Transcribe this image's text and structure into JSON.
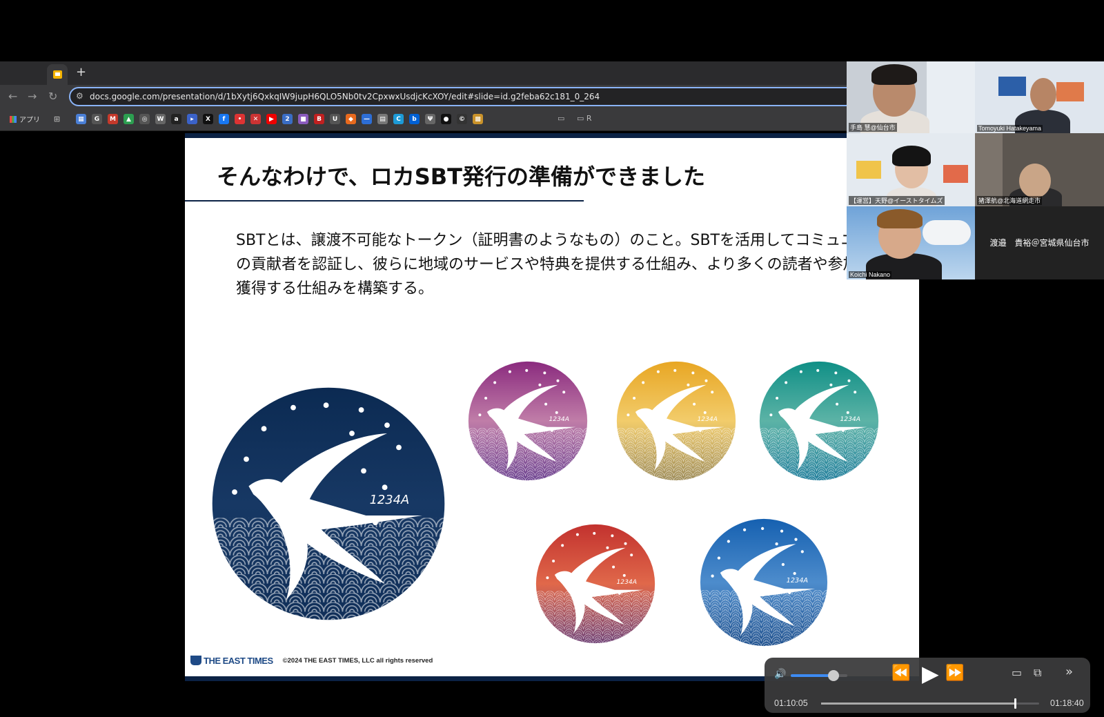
{
  "browser": {
    "url": "docs.google.com/presentation/d/1bXytj6QxkqIW9jupH6QLO5Nb0tv2CpxwxUsdjcKcXOY/edit#slide=id.g2feba62c181_0_264",
    "new_tab_glyph": "+",
    "apps_label": "アプリ",
    "bookmarks": [
      {
        "glyph": "▦",
        "color": "#4a7fd6"
      },
      {
        "glyph": "G",
        "color": "#555"
      },
      {
        "glyph": "M",
        "color": "#c5392b"
      },
      {
        "glyph": "▲",
        "color": "#2c9e50"
      },
      {
        "glyph": "◎",
        "color": "#555"
      },
      {
        "glyph": "W",
        "color": "#666"
      },
      {
        "glyph": "a",
        "color": "#222"
      },
      {
        "glyph": "▸",
        "color": "#3b62c8"
      },
      {
        "glyph": "X",
        "color": "#111"
      },
      {
        "glyph": "f",
        "color": "#1877f2"
      },
      {
        "glyph": "•",
        "color": "#d33"
      },
      {
        "glyph": "✕",
        "color": "#c33"
      },
      {
        "glyph": "▶",
        "color": "#e00"
      },
      {
        "glyph": "2",
        "color": "#3a6dc4"
      },
      {
        "glyph": "■",
        "color": "#8a5bbd"
      },
      {
        "glyph": "B",
        "color": "#c02020"
      },
      {
        "glyph": "U",
        "color": "#555"
      },
      {
        "glyph": "◆",
        "color": "#e86a1e"
      },
      {
        "glyph": "—",
        "color": "#2d6ed6"
      },
      {
        "glyph": "▤",
        "color": "#777"
      },
      {
        "glyph": "C",
        "color": "#1d9bd7"
      },
      {
        "glyph": "b",
        "color": "#0061d5"
      },
      {
        "glyph": "Ψ",
        "color": "#666"
      },
      {
        "glyph": "●",
        "color": "#111"
      },
      {
        "glyph": "©",
        "color": "#333"
      },
      {
        "glyph": "▩",
        "color": "#c9922a"
      }
    ],
    "bookmark_folder_1": "",
    "bookmark_folder_2": "R"
  },
  "slide": {
    "title": "そんなわけで、ロカSBT発行の準備ができました",
    "body": "SBTとは、譲渡不可能なトークン（証明書のようなもの）のこと。SBTを活用してコミュニティの貢献者を認証し、彼らに地域のサービスや特典を提供する仕組み、より多くの読者や参加者を獲得する仕組みを構築する。",
    "badge_number": "1234A",
    "badges": [
      {
        "top": "#0b2a52",
        "mid": "#173864",
        "bottom": "#0f2e58",
        "wave": "#ffffff"
      },
      {
        "top": "#8a2a7e",
        "mid": "#c07da8",
        "bottom": "#6a3f8e",
        "wave": "#ffffff"
      },
      {
        "top": "#e8a623",
        "mid": "#f2cc6b",
        "bottom": "#9c8a56",
        "wave": "#ffffff"
      },
      {
        "top": "#0f8f86",
        "mid": "#5cb3a6",
        "bottom": "#1e7c9a",
        "wave": "#ffffff"
      },
      {
        "top": "#c2312e",
        "mid": "#e0684a",
        "bottom": "#6d3f74",
        "wave": "#ffffff"
      },
      {
        "top": "#1560b0",
        "mid": "#4d8ccc",
        "bottom": "#1c4e8c",
        "wave": "#ffffff"
      }
    ],
    "footer_logo": "THE EAST TIMES",
    "footer_copy": "©2024  THE EAST TIMES, LLC all rights reserved"
  },
  "participants": [
    {
      "name": "手島 慧@仙台市"
    },
    {
      "name": "Tomoyuki Hatakeyama"
    },
    {
      "name": "【運営】天野@イーストタイムズ"
    },
    {
      "name": "猪澤航@北海道網走市"
    },
    {
      "name": "Koichi Nakano"
    },
    {
      "name": "渡邉　貴裕＠宮城県仙台市"
    }
  ],
  "player": {
    "current_time": "01:10:05",
    "duration": "01:18:40",
    "progress": 0.89,
    "volume": 0.75
  }
}
